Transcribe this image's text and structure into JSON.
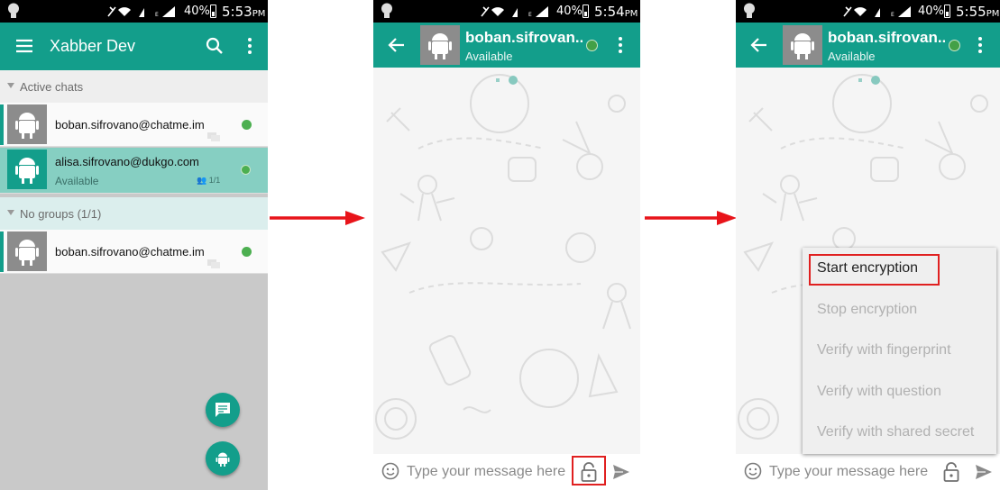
{
  "colors": {
    "primary": "#139e8b",
    "selected_row": "#86cfc2",
    "online": "#4caf50",
    "highlight": "#e02020"
  },
  "phone1": {
    "status": {
      "battery": "40%",
      "time": "5:53",
      "ampm": "PM"
    },
    "toolbar": {
      "title": "Xabber Dev",
      "icons": [
        "menu-icon",
        "search-icon",
        "more-vert-icon"
      ]
    },
    "sections": [
      {
        "label": "Active chats"
      },
      {
        "label": "No groups (1/1)"
      }
    ],
    "contacts": [
      {
        "name": "boban.sifrovano@chatme.im"
      },
      {
        "name": "alisa.sifrovano@dukgo.com",
        "status": "Available",
        "group_count": "1/1"
      },
      {
        "name": "boban.sifrovano@chatme.im"
      }
    ],
    "fabs": [
      "chat-icon",
      "android-icon"
    ]
  },
  "phone2": {
    "status": {
      "battery": "40%",
      "time": "5:54",
      "ampm": "PM"
    },
    "chat": {
      "name": "boban.sifrovan...",
      "status": "Available"
    },
    "compose": {
      "placeholder": "Type your message here"
    }
  },
  "phone3": {
    "status": {
      "battery": "40%",
      "time": "5:55",
      "ampm": "PM"
    },
    "chat": {
      "name": "boban.sifrovan...",
      "status": "Available"
    },
    "compose": {
      "placeholder": "Type your message here"
    },
    "menu": [
      {
        "label": "Start encryption",
        "enabled": true
      },
      {
        "label": "Stop encryption",
        "enabled": false
      },
      {
        "label": "Verify with fingerprint",
        "enabled": false
      },
      {
        "label": "Verify with question",
        "enabled": false
      },
      {
        "label": "Verify with shared secret",
        "enabled": false
      }
    ]
  }
}
